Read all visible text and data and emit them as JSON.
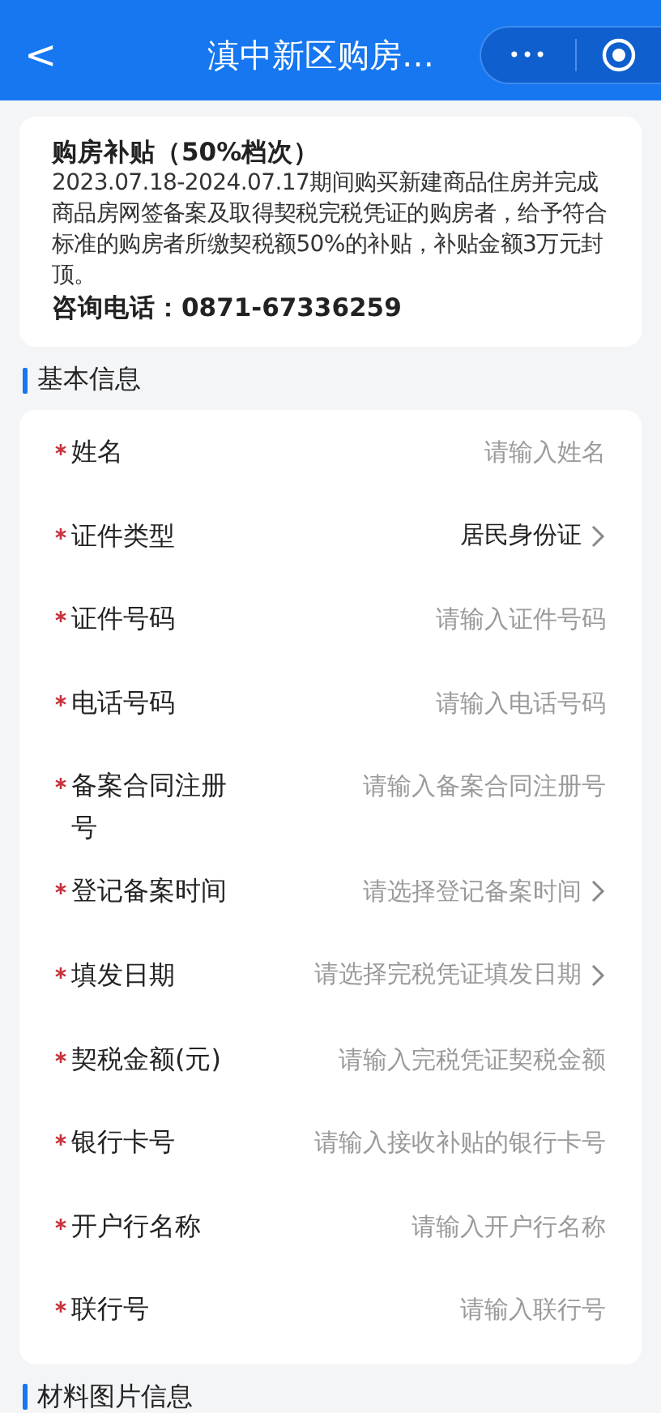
{
  "header": {
    "back": "<",
    "title": "滇中新区购房…",
    "more": "•••"
  },
  "notice": {
    "title": "购房补贴（50%档次）",
    "body": "2023.07.18-2024.07.17期间购买新建商品住房并完成商品房网签备案及取得契税完税凭证的购房者，给予符合标准的购房者所缴契税额50%的补贴，补贴金额3万元封顶。",
    "phone": "咨询电话：0871-67336259"
  },
  "sections": [
    {
      "title": "基本信息",
      "fields": [
        {
          "kind": "input",
          "label": "姓名",
          "required": true,
          "placeholder": "请输入姓名"
        },
        {
          "kind": "select",
          "label": "证件类型",
          "required": true,
          "value": "居民身份证"
        },
        {
          "kind": "input",
          "label": "证件号码",
          "required": true,
          "placeholder": "请输入证件号码"
        },
        {
          "kind": "input",
          "label": "电话号码",
          "required": true,
          "placeholder": "请输入电话号码"
        },
        {
          "kind": "input",
          "label": "备案合同注册号",
          "required": true,
          "placeholder": "请输入备案合同注册号"
        },
        {
          "kind": "select",
          "label": "登记备案时间",
          "required": true,
          "placeholder": "请选择登记备案时间"
        },
        {
          "kind": "select",
          "label": "填发日期",
          "required": true,
          "placeholder": "请选择完税凭证填发日期"
        },
        {
          "kind": "input",
          "label": "契税金额(元)",
          "required": true,
          "placeholder": "请输入完税凭证契税金额"
        },
        {
          "kind": "input",
          "label": "银行卡号",
          "required": true,
          "placeholder": "请输入接收补贴的银行卡号"
        },
        {
          "kind": "input",
          "label": "开户行名称",
          "required": true,
          "placeholder": "请输入开户行名称"
        },
        {
          "kind": "input",
          "label": "联行号",
          "required": true,
          "placeholder": "请输入联行号"
        }
      ]
    },
    {
      "title": "材料图片信息"
    }
  ]
}
